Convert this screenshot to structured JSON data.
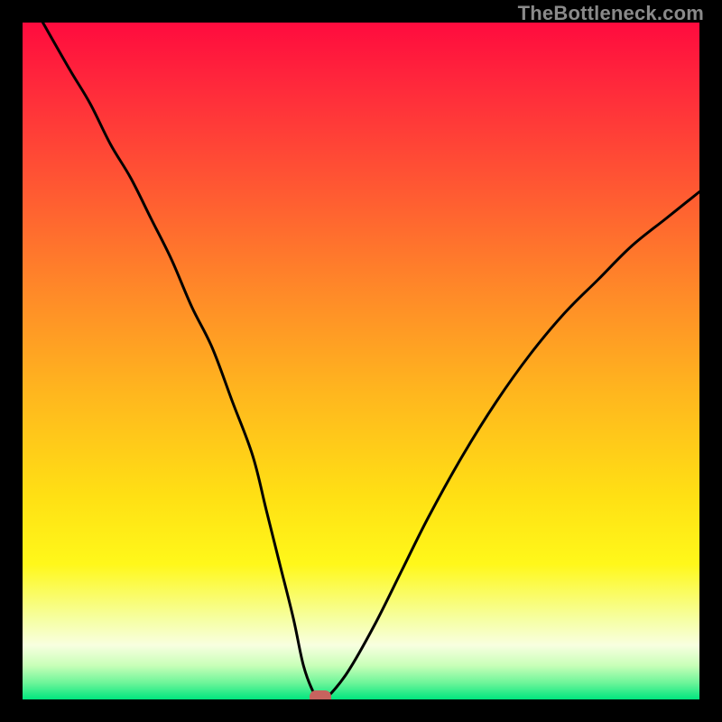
{
  "watermark": "TheBottleneck.com",
  "chart_data": {
    "type": "line",
    "title": "",
    "xlabel": "",
    "ylabel": "",
    "xlim": [
      0,
      100
    ],
    "ylim": [
      0,
      100
    ],
    "grid": false,
    "legend": false,
    "series": [
      {
        "name": "bottleneck-curve",
        "x": [
          3,
          7,
          10,
          13,
          16,
          19,
          22,
          25,
          28,
          31,
          34,
          36,
          38,
          40,
          41.5,
          43,
          44,
          45,
          48,
          52,
          56,
          60,
          65,
          70,
          75,
          80,
          85,
          90,
          95,
          100
        ],
        "values": [
          100,
          93,
          88,
          82,
          77,
          71,
          65,
          58,
          52,
          44,
          36,
          28,
          20,
          12,
          5,
          1,
          0,
          0.3,
          4,
          11,
          19,
          27,
          36,
          44,
          51,
          57,
          62,
          67,
          71,
          75
        ]
      }
    ],
    "marker": {
      "name": "optimal-point",
      "x": 44,
      "y": 0
    },
    "background": {
      "type": "vertical-gradient",
      "stops": [
        {
          "pos": 0.0,
          "color": "#ff0b3e"
        },
        {
          "pos": 0.1,
          "color": "#ff2b3b"
        },
        {
          "pos": 0.25,
          "color": "#ff5a32"
        },
        {
          "pos": 0.4,
          "color": "#ff8a28"
        },
        {
          "pos": 0.55,
          "color": "#ffb71e"
        },
        {
          "pos": 0.7,
          "color": "#ffe014"
        },
        {
          "pos": 0.8,
          "color": "#fff81a"
        },
        {
          "pos": 0.88,
          "color": "#f6ffa0"
        },
        {
          "pos": 0.92,
          "color": "#f8ffe0"
        },
        {
          "pos": 0.95,
          "color": "#c8ffb8"
        },
        {
          "pos": 0.975,
          "color": "#6ff59a"
        },
        {
          "pos": 1.0,
          "color": "#00e57e"
        }
      ]
    }
  }
}
